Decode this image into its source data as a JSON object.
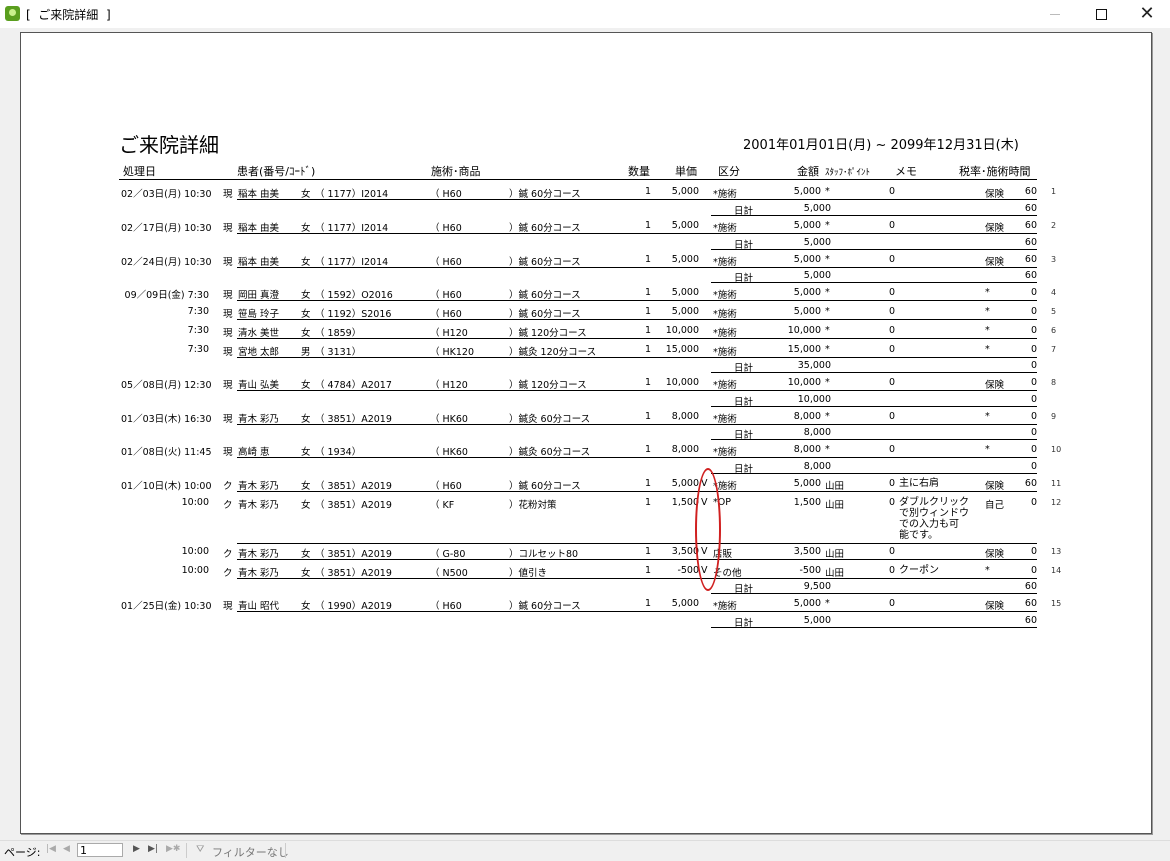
{
  "window": {
    "title": "[  ご来院詳細  ]",
    "minimize_icon": "minimize-icon",
    "maximize_icon": "maximize-icon",
    "close_icon": "close-icon"
  },
  "report": {
    "title": "ご来院詳細",
    "date_range": "2001年01月01日(月) ~     2099年12月31日(木)",
    "headers": {
      "date": "処理日",
      "patient": "患者(番号/ｺｰﾄﾞ)",
      "treatment": "施術･商品",
      "qty": "数量",
      "price": "単価",
      "category": "区分",
      "amount": "金額",
      "staff_point": "ｽﾀｯﾌ･ﾎﾟｲﾝﾄ",
      "memo": "メモ",
      "tax_time": "税率･施術時間"
    },
    "daily_total_label": "日計",
    "rows": [
      {
        "date": "02／03日(月) 10:30",
        "type": "現",
        "name": "稲本 由美",
        "sex": "女",
        "pid": "（  1177）I2014",
        "code": "（ H60",
        "item": "）鍼 60分コース",
        "qty": "1",
        "price": "5,000",
        "v": "",
        "cat": "*施術",
        "amount": "5,000",
        "staff": "*",
        "point": "0",
        "memo": "",
        "tax": "保険",
        "time": "60",
        "num": "1"
      },
      {
        "date": "02／17日(月) 10:30",
        "type": "現",
        "name": "稲本 由美",
        "sex": "女",
        "pid": "（  1177）I2014",
        "code": "（ H60",
        "item": "）鍼 60分コース",
        "qty": "1",
        "price": "5,000",
        "v": "",
        "cat": "*施術",
        "amount": "5,000",
        "staff": "*",
        "point": "0",
        "memo": "",
        "tax": "保険",
        "time": "60",
        "num": "2"
      },
      {
        "date": "02／24日(月) 10:30",
        "type": "現",
        "name": "稲本 由美",
        "sex": "女",
        "pid": "（  1177）I2014",
        "code": "（ H60",
        "item": "）鍼 60分コース",
        "qty": "1",
        "price": "5,000",
        "v": "",
        "cat": "*施術",
        "amount": "5,000",
        "staff": "*",
        "point": "0",
        "memo": "",
        "tax": "保険",
        "time": "60",
        "num": "3"
      },
      {
        "date": "09／09日(金) 7:30",
        "type": "現",
        "name": "岡田 真澄",
        "sex": "女",
        "pid": "（  1592）O2016",
        "code": "（ H60",
        "item": "）鍼 60分コース",
        "qty": "1",
        "price": "5,000",
        "v": "",
        "cat": "*施術",
        "amount": "5,000",
        "staff": "*",
        "point": "0",
        "memo": "",
        "tax": "*",
        "time": "0",
        "num": "4"
      },
      {
        "date": "7:30",
        "type": "現",
        "name": "笹島 玲子",
        "sex": "女",
        "pid": "（  1192）S2016",
        "code": "（ H60",
        "item": "）鍼 60分コース",
        "qty": "1",
        "price": "5,000",
        "v": "",
        "cat": "*施術",
        "amount": "5,000",
        "staff": "*",
        "point": "0",
        "memo": "",
        "tax": "*",
        "time": "0",
        "num": "5"
      },
      {
        "date": "7:30",
        "type": "現",
        "name": "清水 美世",
        "sex": "女",
        "pid": "（  1859）",
        "code": "（ H120",
        "item": "）鍼 120分コース",
        "qty": "1",
        "price": "10,000",
        "v": "",
        "cat": "*施術",
        "amount": "10,000",
        "staff": "*",
        "point": "0",
        "memo": "",
        "tax": "*",
        "time": "0",
        "num": "6"
      },
      {
        "date": "7:30",
        "type": "現",
        "name": "宮地 太郎",
        "sex": "男",
        "pid": "（  3131）",
        "code": "（ HK120",
        "item": "）鍼灸 120分コース",
        "qty": "1",
        "price": "15,000",
        "v": "",
        "cat": "*施術",
        "amount": "15,000",
        "staff": "*",
        "point": "0",
        "memo": "",
        "tax": "*",
        "time": "0",
        "num": "7"
      },
      {
        "date": "05／08日(月) 12:30",
        "type": "現",
        "name": "青山 弘美",
        "sex": "女",
        "pid": "（  4784）A2017",
        "code": "（ H120",
        "item": "）鍼 120分コース",
        "qty": "1",
        "price": "10,000",
        "v": "",
        "cat": "*施術",
        "amount": "10,000",
        "staff": "*",
        "point": "0",
        "memo": "",
        "tax": "保険",
        "time": "0",
        "num": "8"
      },
      {
        "date": "01／03日(木) 16:30",
        "type": "現",
        "name": "青木 彩乃",
        "sex": "女",
        "pid": "（  3851）A2019",
        "code": "（ HK60",
        "item": "）鍼灸 60分コース",
        "qty": "1",
        "price": "8,000",
        "v": "",
        "cat": "*施術",
        "amount": "8,000",
        "staff": "*",
        "point": "0",
        "memo": "",
        "tax": "*",
        "time": "0",
        "num": "9"
      },
      {
        "date": "01／08日(火) 11:45",
        "type": "現",
        "name": "高崎 恵",
        "sex": "女",
        "pid": "（  1934）",
        "code": "（ HK60",
        "item": "）鍼灸 60分コース",
        "qty": "1",
        "price": "8,000",
        "v": "",
        "cat": "*施術",
        "amount": "8,000",
        "staff": "*",
        "point": "0",
        "memo": "",
        "tax": "*",
        "time": "0",
        "num": "10"
      },
      {
        "date": "01／10日(木) 10:00",
        "type": "ク",
        "name": "青木 彩乃",
        "sex": "女",
        "pid": "（  3851）A2019",
        "code": "（ H60",
        "item": "）鍼 60分コース",
        "qty": "1",
        "price": "5,000",
        "v": "V",
        "cat": "*施術",
        "amount": "5,000",
        "staff": "山田",
        "point": "0",
        "memo": "主に右肩",
        "tax": "保険",
        "time": "60",
        "num": "11"
      },
      {
        "date": "10:00",
        "type": "ク",
        "name": "青木 彩乃",
        "sex": "女",
        "pid": "（  3851）A2019",
        "code": "（ KF",
        "item": "）花粉対策",
        "qty": "1",
        "price": "1,500",
        "v": "V",
        "cat": "*OP",
        "amount": "1,500",
        "staff": "山田",
        "point": "0",
        "memo": "ダブルクリック\nで別ウィンドウ\nでの入力も可\n能です。",
        "tax": "自己",
        "time": "0",
        "num": "12"
      },
      {
        "date": "10:00",
        "type": "ク",
        "name": "青木 彩乃",
        "sex": "女",
        "pid": "（  3851）A2019",
        "code": "（ G-80",
        "item": "）コルセット80",
        "qty": "1",
        "price": "3,500",
        "v": "V",
        "cat": "店販",
        "amount": "3,500",
        "staff": "山田",
        "point": "0",
        "memo": "",
        "tax": "保険",
        "time": "0",
        "num": "13"
      },
      {
        "date": "10:00",
        "type": "ク",
        "name": "青木 彩乃",
        "sex": "女",
        "pid": "（  3851）A2019",
        "code": "（ N500",
        "item": "）値引き",
        "qty": "1",
        "price": "-500",
        "v": "V",
        "cat": "その他",
        "amount": "-500",
        "staff": "山田",
        "point": "0",
        "memo": "クーポン",
        "tax": "*",
        "time": "0",
        "num": "14"
      },
      {
        "date": "01／25日(金) 10:30",
        "type": "現",
        "name": "青山 昭代",
        "sex": "女",
        "pid": "（  1990）A2019",
        "code": "（ H60",
        "item": "）鍼 60分コース",
        "qty": "1",
        "price": "5,000",
        "v": "",
        "cat": "*施術",
        "amount": "5,000",
        "staff": "*",
        "point": "0",
        "memo": "",
        "tax": "保険",
        "time": "60",
        "num": "15"
      }
    ],
    "daily_totals": [
      {
        "amount": "5,000",
        "time": "60"
      },
      {
        "amount": "5,000",
        "time": "60"
      },
      {
        "amount": "5,000",
        "time": "60"
      },
      {
        "amount": "35,000",
        "time": "0"
      },
      {
        "amount": "10,000",
        "time": "0"
      },
      {
        "amount": "8,000",
        "time": "0"
      },
      {
        "amount": "8,000",
        "time": "0"
      },
      {
        "amount": "9,500",
        "time": "60"
      },
      {
        "amount": "5,000",
        "time": "60"
      }
    ]
  },
  "navbar": {
    "page_label": "ページ:",
    "page_value": "1",
    "first_icon": "first-page-icon",
    "prev_icon": "prev-page-icon",
    "next_icon": "next-page-icon",
    "last_icon": "last-page-icon",
    "new_icon": "new-record-icon",
    "filter_icon": "filter-icon",
    "filter_label": "フィルターなし"
  },
  "colors": {
    "highlight": "#d02020",
    "app_icon": "#5a9e1e"
  }
}
